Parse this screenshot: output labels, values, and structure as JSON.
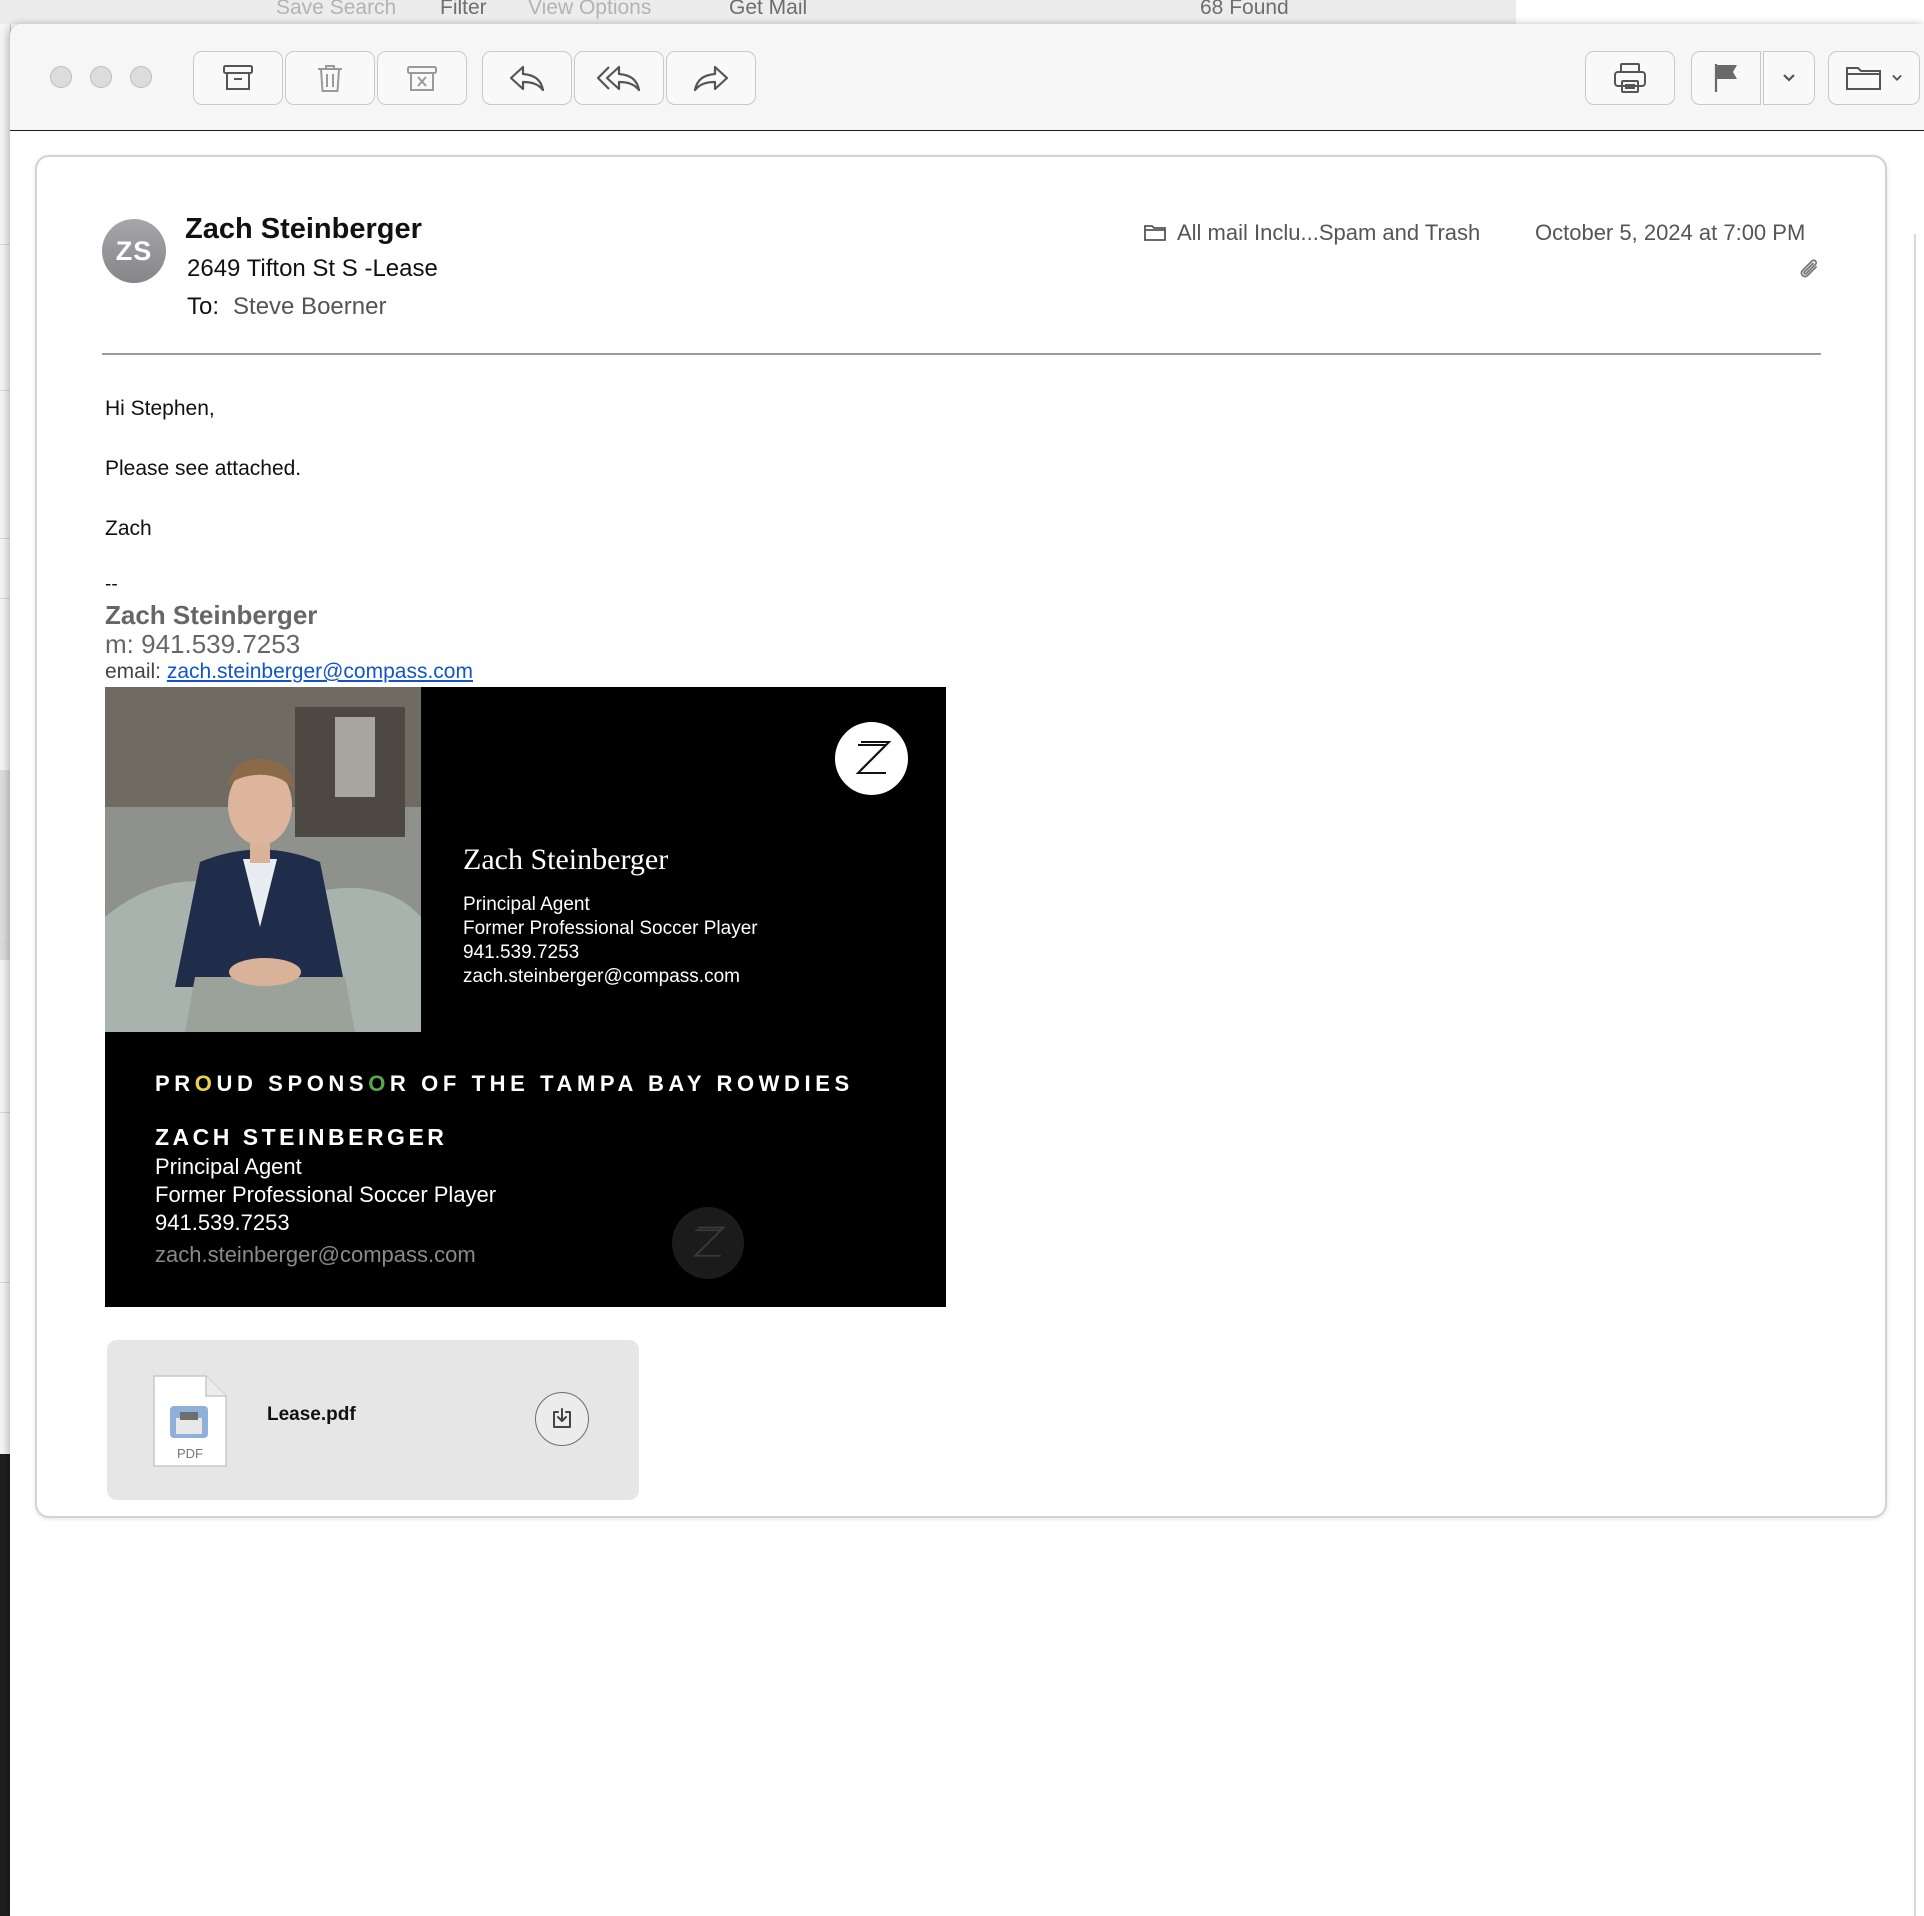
{
  "background_window": {
    "toolbar_items": [
      "Save Search",
      "Filter",
      "View Options",
      "Get Mail"
    ],
    "found_count": "68 Found"
  },
  "toolbar": {
    "buttons": [
      "archive",
      "delete",
      "junk",
      "reply",
      "reply-all",
      "forward",
      "print",
      "flag",
      "flag-menu",
      "move-to-folder"
    ]
  },
  "message": {
    "avatar_initials": "ZS",
    "sender": "Zach Steinberger",
    "subject": "2649 Tifton St S -Lease",
    "to_label": "To:",
    "to_name": "Steve Boerner",
    "mailbox": "All mail Inclu...Spam and Trash",
    "date": "October 5, 2024 at 7:00 PM",
    "body": {
      "greeting": "Hi Stephen,",
      "line1": "Please see attached.",
      "closing": "Zach"
    },
    "signature": {
      "dash": "--",
      "name": "Zach Steinberger",
      "phone": "m: 941.539.7253",
      "email_label": "email: ",
      "email": "zach.steinberger@compass.com"
    },
    "business_card": {
      "name": "Zach Steinberger",
      "title": "Principal Agent",
      "subtitle": "Former Professional Soccer Player",
      "phone": "941.539.7253",
      "email": "zach.steinberger@compass.com",
      "sponsor_a": "PR",
      "sponsor_o1": "O",
      "sponsor_b": "UD SPONS",
      "sponsor_o2": "O",
      "sponsor_c": "R OF THE TAMPA BAY ROWDIES",
      "name_caps": "ZACH STEINBERGER"
    },
    "attachment": {
      "filename": "Lease.pdf",
      "type_label": "PDF"
    }
  },
  "colors": {
    "link": "#1155cc",
    "sponsor_o_yellow": "#e7d24a",
    "sponsor_o_green": "#5aa64c"
  }
}
